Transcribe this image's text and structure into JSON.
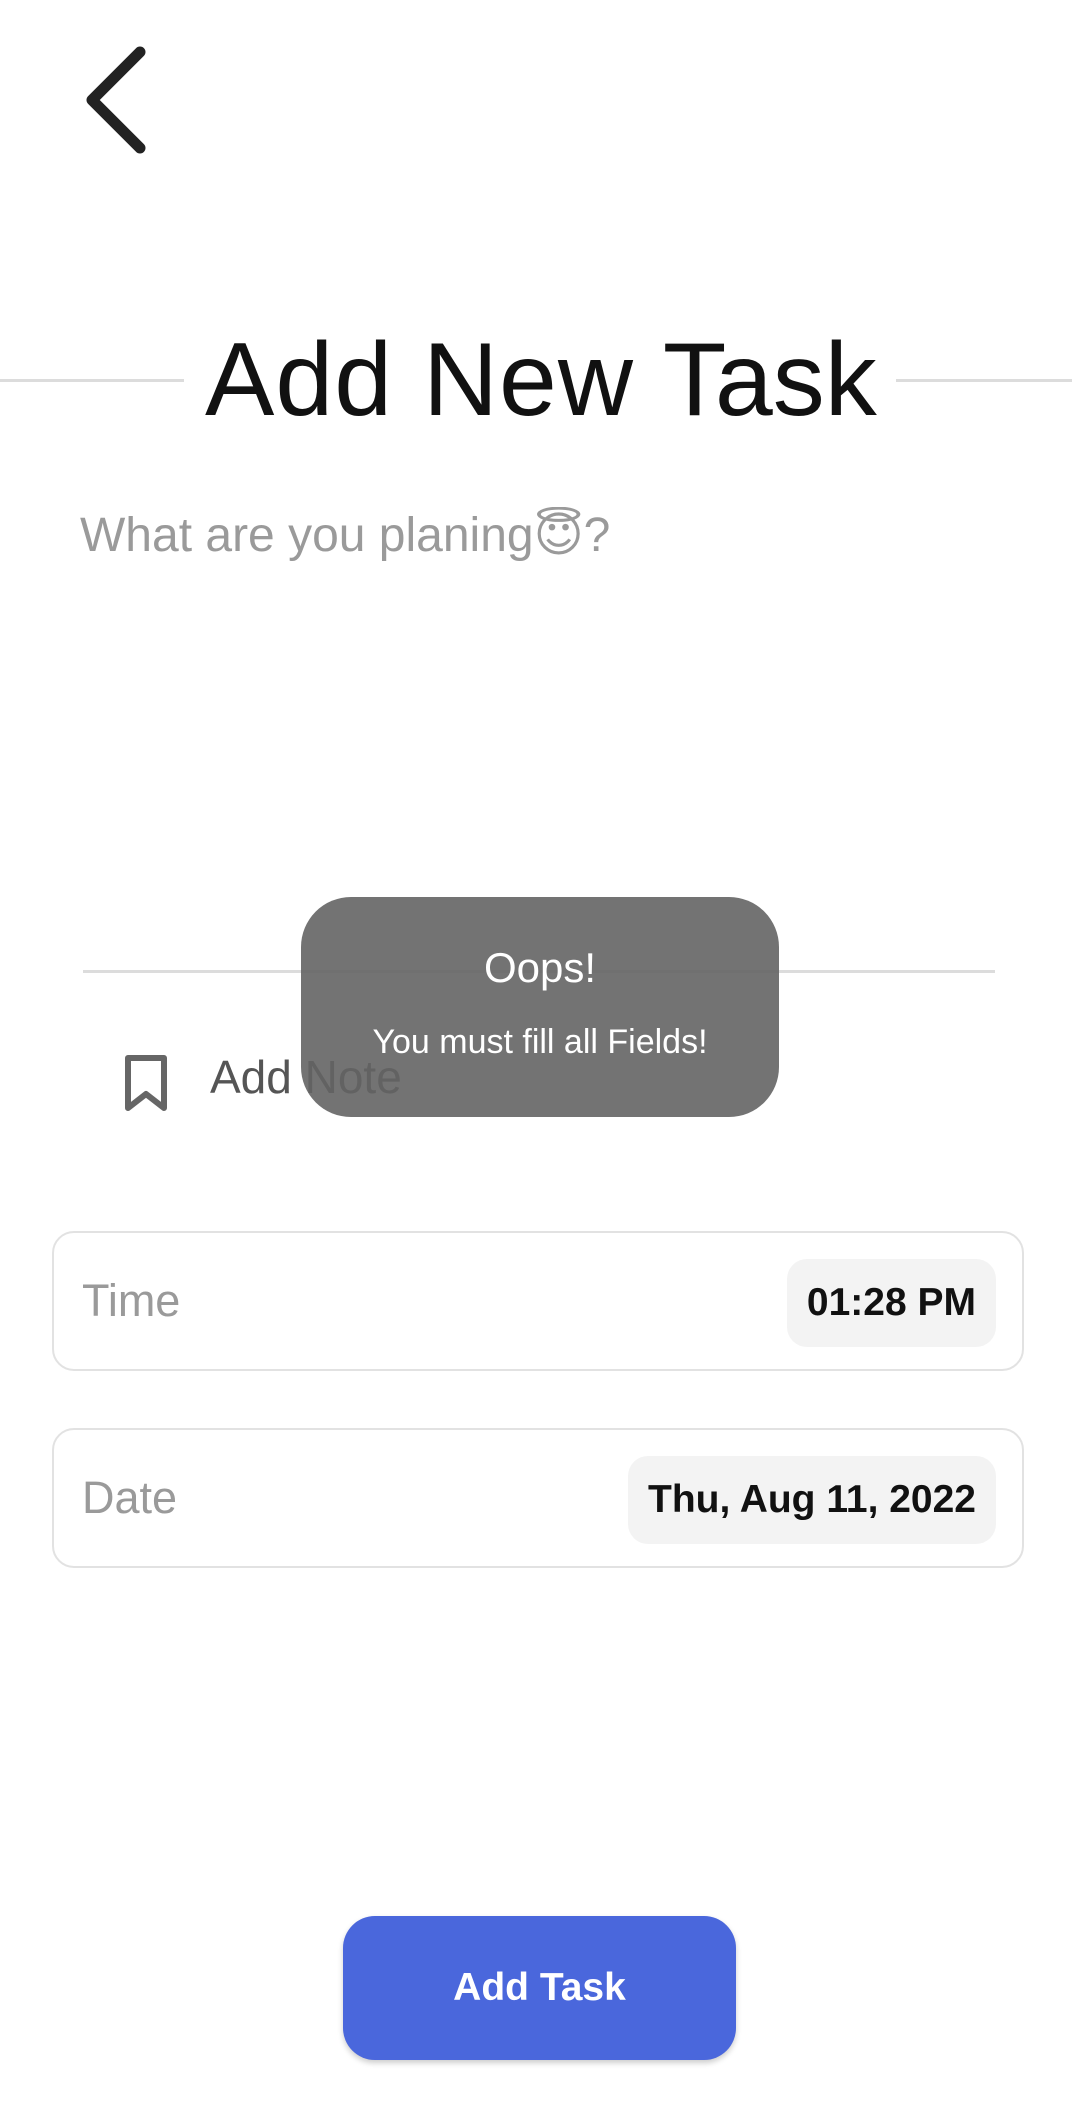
{
  "header": {
    "back_icon": "chevron-left-icon"
  },
  "title": {
    "light": "Add New",
    "bold": "Task"
  },
  "task_input": {
    "value": "",
    "placeholder": "What are you planing😇?"
  },
  "note": {
    "icon": "bookmark-icon",
    "label": "Add Note"
  },
  "time_field": {
    "label": "Time",
    "value": "01:28 PM"
  },
  "date_field": {
    "label": "Date",
    "value": "Thu, Aug 11, 2022"
  },
  "toast": {
    "title": "Oops!",
    "message": "You must fill all Fields!"
  },
  "add_button": {
    "label": "Add Task"
  },
  "colors": {
    "accent": "#4a67dc",
    "toast_bg": "#646464",
    "placeholder": "#9a9a9a",
    "chip_bg": "#f3f3f3"
  }
}
